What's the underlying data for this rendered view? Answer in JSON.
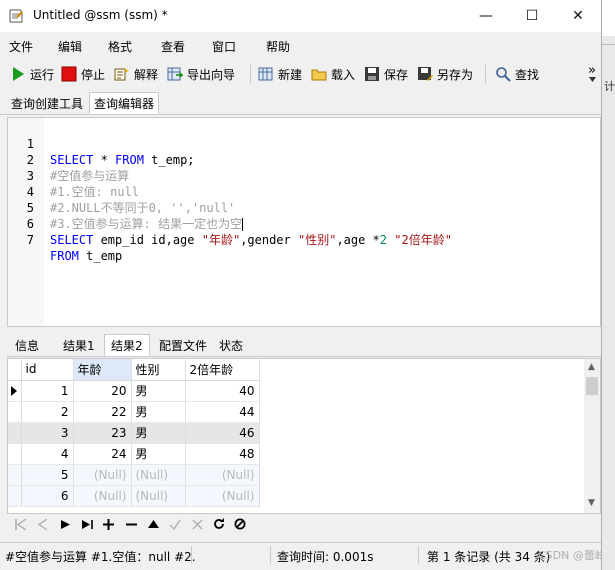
{
  "window": {
    "title": "Untitled @ssm (ssm) *",
    "minimize_glyph": "—",
    "maximize_glyph": "☐",
    "close_glyph": "✕"
  },
  "menu": [
    "文件",
    "编辑",
    "格式",
    "查看",
    "窗口",
    "帮助"
  ],
  "toolbar": {
    "run": "运行",
    "stop": "停止",
    "explain": "解释",
    "export_wizard": "导出向导",
    "new": "新建",
    "load": "载入",
    "save": "保存",
    "save_as": "另存为",
    "find": "查找",
    "overflow": "»"
  },
  "query_tabs": [
    "查询创建工具",
    "查询编辑器"
  ],
  "editor": {
    "lines": [
      {
        "n": "1",
        "text": "SELECT * FROM t_emp;"
      },
      {
        "n": "2",
        "text": "#空值参与运算"
      },
      {
        "n": "3",
        "text": "#1.空值: null"
      },
      {
        "n": "4",
        "text": "#2.NULL不等同于0, '','null'"
      },
      {
        "n": "5",
        "text": "#3.空值参与运算: 结果一定也为空"
      },
      {
        "n": "6",
        "text": "SELECT emp_id id,age \"年龄\",gender \"性别\",age *2 \"2倍年龄\""
      },
      {
        "n": "7",
        "text": "FROM t_emp"
      }
    ]
  },
  "result_tabs": [
    "信息",
    "结果1",
    "结果2",
    "配置文件",
    "状态"
  ],
  "grid": {
    "columns": [
      "id",
      "年龄",
      "性别",
      "2倍年龄"
    ],
    "rows": [
      {
        "id": "1",
        "age": "20",
        "gender": "男",
        "double": "40"
      },
      {
        "id": "2",
        "age": "22",
        "gender": "男",
        "double": "44"
      },
      {
        "id": "3",
        "age": "23",
        "gender": "男",
        "double": "46"
      },
      {
        "id": "4",
        "age": "24",
        "gender": "男",
        "double": "48"
      },
      {
        "id": "5",
        "age": "(Null)",
        "gender": "(Null)",
        "double": "(Null)"
      },
      {
        "id": "6",
        "age": "(Null)",
        "gender": "(Null)",
        "double": "(Null)"
      }
    ]
  },
  "status": {
    "sql_preview": "#空值参与运算 #1.空值：null #2.",
    "query_time": "查询时间: 0.001s",
    "record_info": "第 1 条记录 (共 34 条)",
    "watermark": "CSDN @蕾峰"
  },
  "side": {
    "char": "计"
  },
  "colors": {
    "keyword": "#0000ff",
    "comment": "#a0a0a0",
    "string": "#a31515",
    "number": "#098658",
    "run_green": "#1a9a1a",
    "stop_red": "#e01010"
  }
}
